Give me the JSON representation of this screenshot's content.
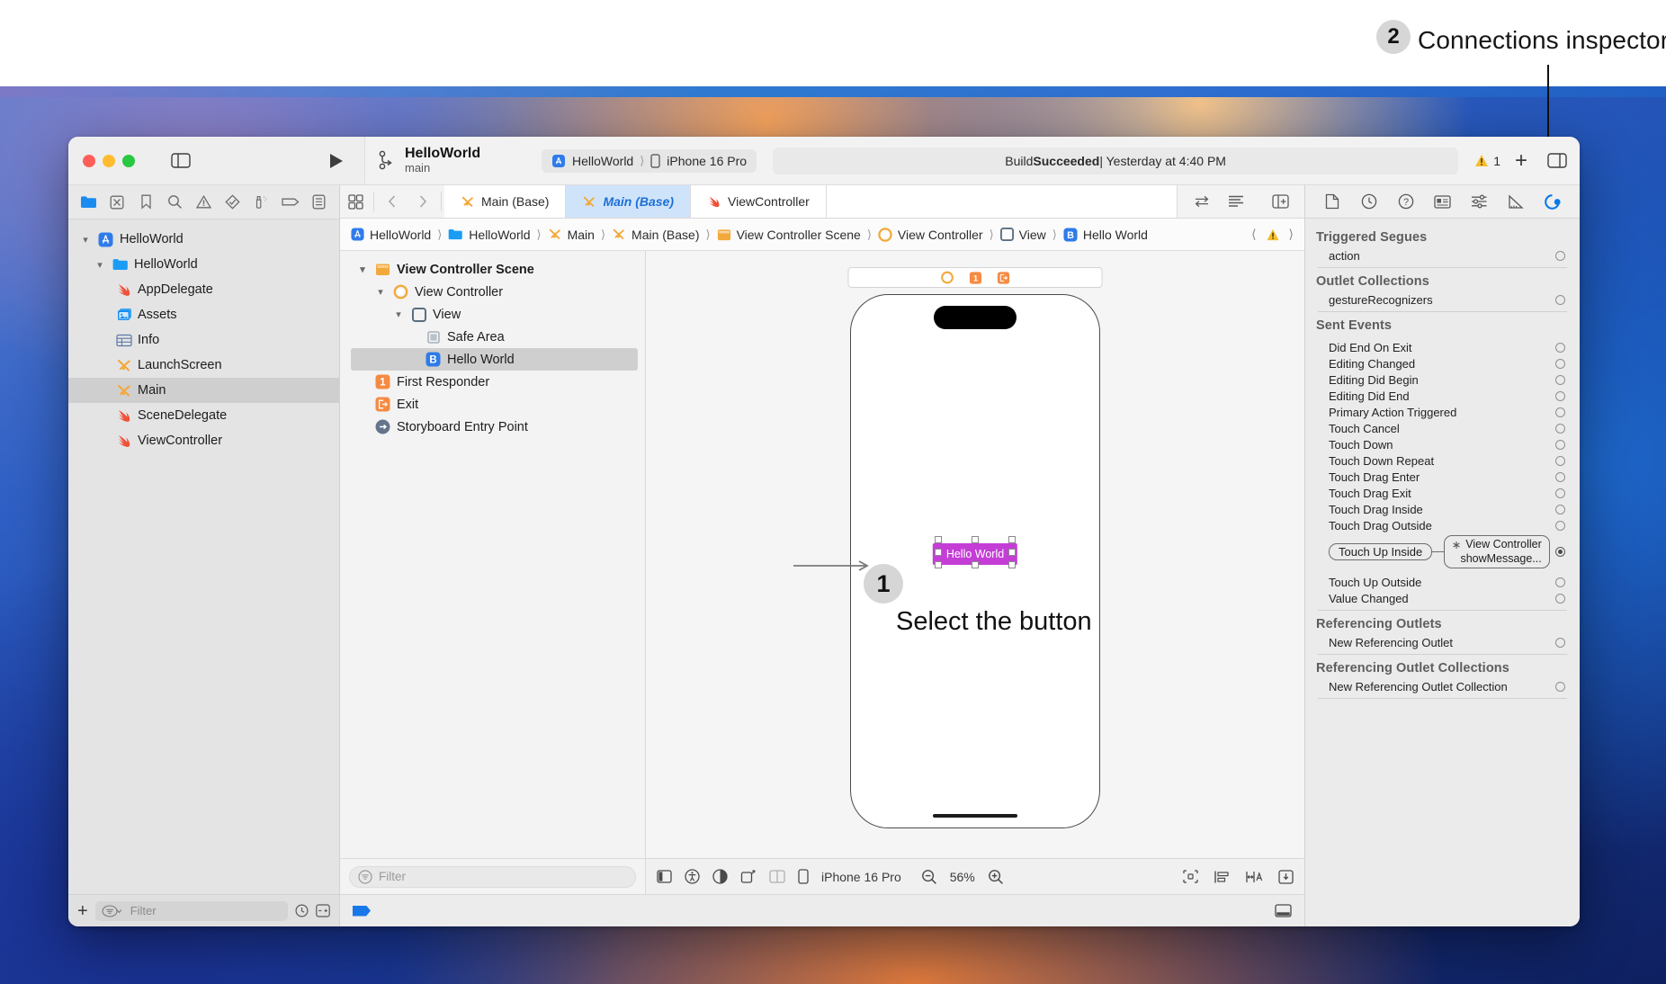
{
  "annotations": [
    {
      "number": "2",
      "text": "Connections inspector"
    },
    {
      "number": "1",
      "text": "Select the button"
    }
  ],
  "titlebar": {
    "scheme_name": "HelloWorld",
    "branch": "main",
    "destination_scheme": "HelloWorld",
    "destination_device": "iPhone 16 Pro",
    "status": "Build Succeeded | Yesterday at 4:40 PM",
    "status_prefix": "Build ",
    "status_bold": "Succeeded",
    "status_suffix": " | Yesterday at 4:40 PM",
    "warning_count": "1",
    "add_label": "+",
    "icons": {
      "sidebar_toggle": "sidebar-toggle-icon",
      "run": "run-play-icon",
      "warning": "warning-triangle-icon",
      "inspector_toggle": "inspector-toggle-icon"
    }
  },
  "navigator": {
    "tabs": [
      {
        "name": "project-navigator",
        "icon": "folder-icon",
        "active": true
      },
      {
        "name": "source-control-navigator",
        "icon": "source-control-icon",
        "active": false
      },
      {
        "name": "bookmark-navigator",
        "icon": "bookmark-icon",
        "active": false
      },
      {
        "name": "find-navigator",
        "icon": "search-icon",
        "active": false
      },
      {
        "name": "issue-navigator",
        "icon": "warning-triangle-icon",
        "active": false
      },
      {
        "name": "test-navigator",
        "icon": "diamond-check-icon",
        "active": false
      },
      {
        "name": "debug-navigator",
        "icon": "spray-icon",
        "active": false
      },
      {
        "name": "breakpoint-navigator",
        "icon": "breakpoint-icon",
        "active": false
      },
      {
        "name": "report-navigator",
        "icon": "report-icon",
        "active": false
      }
    ],
    "tree": [
      {
        "label": "HelloWorld",
        "icon": "xcode-project-icon",
        "depth": 0,
        "twisty": "down",
        "selected": false
      },
      {
        "label": "HelloWorld",
        "icon": "folder-icon",
        "depth": 1,
        "twisty": "down",
        "selected": false
      },
      {
        "label": "AppDelegate",
        "icon": "swift-file-icon",
        "depth": 2,
        "twisty": "",
        "selected": false
      },
      {
        "label": "Assets",
        "icon": "assets-icon",
        "depth": 2,
        "twisty": "",
        "selected": false
      },
      {
        "label": "Info",
        "icon": "plist-icon",
        "depth": 2,
        "twisty": "",
        "selected": false
      },
      {
        "label": "LaunchScreen",
        "icon": "storyboard-icon",
        "depth": 2,
        "twisty": "",
        "selected": false
      },
      {
        "label": "Main",
        "icon": "storyboard-icon",
        "depth": 2,
        "twisty": "",
        "selected": true
      },
      {
        "label": "SceneDelegate",
        "icon": "swift-file-icon",
        "depth": 2,
        "twisty": "",
        "selected": false
      },
      {
        "label": "ViewController",
        "icon": "swift-file-icon",
        "depth": 2,
        "twisty": "",
        "selected": false
      }
    ],
    "filter_placeholder": "Filter",
    "add_label": "+"
  },
  "editor": {
    "tabs": [
      {
        "label": "Main (Base)",
        "icon": "storyboard-icon",
        "active": false
      },
      {
        "label": "Main (Base)",
        "icon": "storyboard-icon",
        "active": true
      },
      {
        "label": "ViewController",
        "icon": "swift-file-icon",
        "active": false
      }
    ],
    "breadcrumb": [
      {
        "label": "HelloWorld",
        "icon": "xcode-project-icon"
      },
      {
        "label": "HelloWorld",
        "icon": "folder-icon"
      },
      {
        "label": "Main",
        "icon": "storyboard-icon"
      },
      {
        "label": "Main (Base)",
        "icon": "storyboard-icon"
      },
      {
        "label": "View Controller Scene",
        "icon": "scene-icon"
      },
      {
        "label": "View Controller",
        "icon": "view-controller-icon"
      },
      {
        "label": "View",
        "icon": "view-icon"
      },
      {
        "label": "Hello World",
        "icon": "button-icon"
      }
    ],
    "outline": [
      {
        "label": "View Controller Scene",
        "icon": "scene-icon",
        "depth": 0,
        "twisty": "down",
        "selected": false,
        "bold": true
      },
      {
        "label": "View Controller",
        "icon": "view-controller-icon",
        "depth": 1,
        "twisty": "down",
        "selected": false,
        "bold": false
      },
      {
        "label": "View",
        "icon": "view-icon",
        "depth": 2,
        "twisty": "down",
        "selected": false,
        "bold": false
      },
      {
        "label": "Safe Area",
        "icon": "safe-area-icon",
        "depth": 3,
        "twisty": "",
        "selected": false,
        "bold": false
      },
      {
        "label": "Hello World",
        "icon": "button-icon",
        "depth": 3,
        "twisty": "",
        "selected": true,
        "bold": false
      },
      {
        "label": "First Responder",
        "icon": "first-responder-icon",
        "depth": 1,
        "twisty": "",
        "selected": false,
        "bold": false
      },
      {
        "label": "Exit",
        "icon": "exit-icon",
        "depth": 1,
        "twisty": "",
        "selected": false,
        "bold": false
      },
      {
        "label": "Storyboard Entry Point",
        "icon": "entry-point-icon",
        "depth": 1,
        "twisty": "",
        "selected": false,
        "bold": false
      }
    ],
    "outline_filter_placeholder": "Filter",
    "canvas": {
      "button_label": "Hello World",
      "device_name": "iPhone 16 Pro",
      "zoom": "56%",
      "scene_dock_icons": [
        "view-controller-icon",
        "first-responder-icon",
        "exit-icon"
      ]
    }
  },
  "inspector": {
    "tabs": [
      {
        "name": "file-inspector",
        "icon": "document-icon",
        "active": false
      },
      {
        "name": "history-inspector",
        "icon": "clock-icon",
        "active": false
      },
      {
        "name": "quick-help-inspector",
        "icon": "question-icon",
        "active": false
      },
      {
        "name": "identity-inspector",
        "icon": "id-card-icon",
        "active": false
      },
      {
        "name": "attributes-inspector",
        "icon": "sliders-icon",
        "active": false
      },
      {
        "name": "size-inspector",
        "icon": "ruler-icon",
        "active": false
      },
      {
        "name": "connections-inspector",
        "icon": "connections-icon",
        "active": true
      }
    ],
    "sections": [
      {
        "title": "Triggered Segues",
        "rows": [
          {
            "label": "action",
            "state": "empty"
          }
        ]
      },
      {
        "title": "Outlet Collections",
        "rows": [
          {
            "label": "gestureRecognizers",
            "state": "empty"
          }
        ]
      },
      {
        "title": "Sent Events",
        "rows": [
          {
            "label": "Did End On Exit",
            "state": "empty"
          },
          {
            "label": "Editing Changed",
            "state": "empty"
          },
          {
            "label": "Editing Did Begin",
            "state": "empty"
          },
          {
            "label": "Editing Did End",
            "state": "empty"
          },
          {
            "label": "Primary Action Triggered",
            "state": "empty"
          },
          {
            "label": "Touch Cancel",
            "state": "empty"
          },
          {
            "label": "Touch Down",
            "state": "empty"
          },
          {
            "label": "Touch Down Repeat",
            "state": "empty"
          },
          {
            "label": "Touch Drag Enter",
            "state": "empty"
          },
          {
            "label": "Touch Drag Exit",
            "state": "empty"
          },
          {
            "label": "Touch Drag Inside",
            "state": "empty"
          },
          {
            "label": "Touch Drag Outside",
            "state": "empty"
          },
          {
            "label": "Touch Up Inside",
            "state": "connected",
            "connection": {
              "target": "View Controller",
              "action": "showMessage..."
            }
          },
          {
            "label": "Touch Up Outside",
            "state": "empty"
          },
          {
            "label": "Value Changed",
            "state": "empty"
          }
        ]
      },
      {
        "title": "Referencing Outlets",
        "rows": [
          {
            "label": "New Referencing Outlet",
            "state": "empty"
          }
        ]
      },
      {
        "title": "Referencing Outlet Collections",
        "rows": [
          {
            "label": "New Referencing Outlet Collection",
            "state": "empty"
          }
        ]
      }
    ]
  },
  "colors": {
    "accent_blue": "#0a78e8",
    "button_purple": "#c43ed6",
    "swift_orange": "#f05138",
    "storyboard_yellow": "#f2a93b",
    "warning_yellow": "#f5bd2e",
    "selected_tab_bg": "#cfe4fb"
  }
}
